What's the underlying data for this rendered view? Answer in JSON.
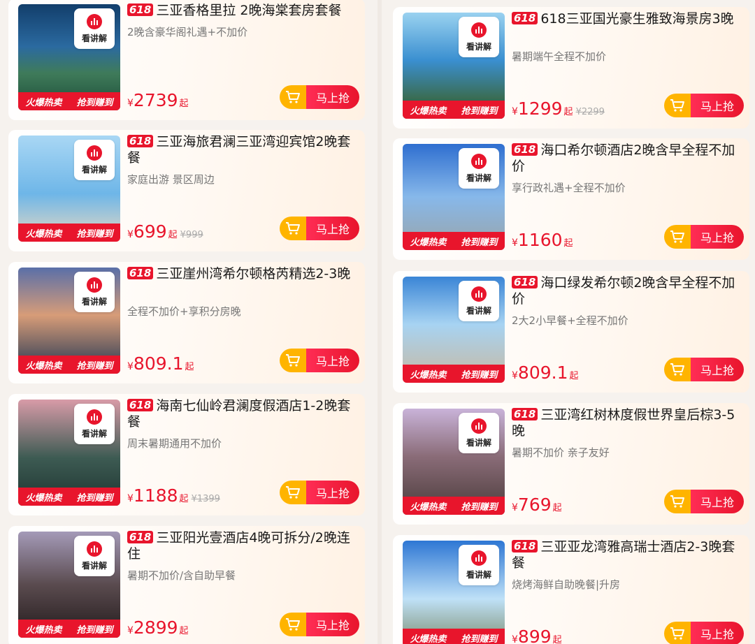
{
  "common": {
    "live_label": "看讲解",
    "tag_hot": "火爆热卖",
    "tag_earn": "抢到赚到",
    "badge": "618",
    "currency": "¥",
    "qi": "起",
    "buy_label": "马上抢"
  },
  "left": [
    {
      "title": "三亚香格里拉 2晚海棠套房套餐",
      "sub": "2晚含豪华阁礼遇+不加价",
      "price": "2739",
      "orig": ""
    },
    {
      "title": "三亚海旅君澜三亚湾迎宾馆2晚套餐",
      "sub": "家庭出游 景区周边",
      "price": "699",
      "orig": "¥999"
    },
    {
      "title": "三亚崖州湾希尔顿格芮精选2-3晚",
      "sub": "全程不加价+享积分房晚",
      "price": "809.1",
      "orig": ""
    },
    {
      "title": "海南七仙岭君澜度假酒店1-2晚套餐",
      "sub": "周末暑期通用不加价",
      "price": "1188",
      "orig": "¥1399"
    },
    {
      "title": "三亚阳光壹酒店4晚可拆分/2晚连住",
      "sub": "暑期不加价/含自助早餐",
      "price": "2899",
      "orig": ""
    }
  ],
  "right": [
    {
      "title": "618三亚国光豪生雅致海景房3晚",
      "sub": "暑期端午全程不加价",
      "price": "1299",
      "orig": "¥2299"
    },
    {
      "title": "海口希尔顿酒店2晚含早全程不加价",
      "sub": "享行政礼遇+全程不加价",
      "price": "1160",
      "orig": ""
    },
    {
      "title": "海口绿发希尔顿2晚含早全程不加价",
      "sub": "2大2小早餐+全程不加价",
      "price": "809.1",
      "orig": ""
    },
    {
      "title": "三亚湾红树林度假世界皇后棕3-5晚",
      "sub": "暑期不加价 亲子友好",
      "price": "769",
      "orig": ""
    },
    {
      "title": "三亚亚龙湾雅高瑞士酒店2-3晚套餐",
      "sub": "烧烤海鲜自助晚餐|升房",
      "price": "899",
      "orig": ""
    }
  ]
}
